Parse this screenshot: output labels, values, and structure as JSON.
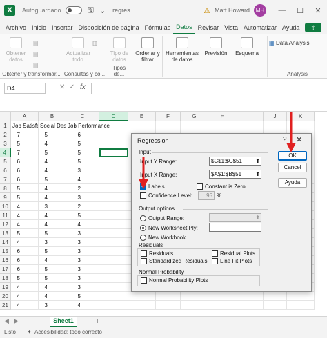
{
  "titlebar": {
    "autosave_label": "Autoguardado",
    "filename": "regres...",
    "user_name": "Matt Howard",
    "user_initials": "MH",
    "minimize": "—",
    "maximize": "☐",
    "close": "✕"
  },
  "menu": {
    "tabs": [
      "Archivo",
      "Inicio",
      "Insertar",
      "Disposición de página",
      "Fórmulas",
      "Datos",
      "Revisar",
      "Vista",
      "Automatizar",
      "Ayuda"
    ],
    "active_index": 5
  },
  "ribbon": {
    "obtener_datos": "Obtener datos",
    "actualizar_todo": "Actualizar todo",
    "tipo_de_datos": "Tipo de datos",
    "ordenar_filtrar": "Ordenar y filtrar",
    "herramientas_datos": "Herramientas de datos",
    "prevision": "Previsión",
    "esquema": "Esquema",
    "data_analysis": "Data Analysis",
    "group_obtener": "Obtener y transformar...",
    "group_consultas": "Consultas y co...",
    "group_tipos": "Tipos de...",
    "group_analysis": "Analysis"
  },
  "formula_bar": {
    "name_box": "D4",
    "cancel": "✕",
    "enter": "✓",
    "fx": "fx"
  },
  "sheet": {
    "columns": [
      "A",
      "B",
      "C",
      "D",
      "E",
      "F",
      "G",
      "H",
      "I",
      "J",
      "K"
    ],
    "rows": [
      "1",
      "2",
      "3",
      "4",
      "5",
      "6",
      "7",
      "8",
      "9",
      "10",
      "11",
      "12",
      "13",
      "14",
      "15",
      "16",
      "17",
      "18",
      "19",
      "20",
      "21"
    ],
    "headers": [
      "Job Satisfac",
      "Social Des",
      "Job Performance"
    ],
    "data": [
      [
        "7",
        "5",
        "6"
      ],
      [
        "5",
        "4",
        "5"
      ],
      [
        "7",
        "5",
        "5"
      ],
      [
        "6",
        "4",
        "5"
      ],
      [
        "6",
        "4",
        "3"
      ],
      [
        "6",
        "5",
        "4"
      ],
      [
        "5",
        "4",
        "2"
      ],
      [
        "5",
        "4",
        "3"
      ],
      [
        "4",
        "3",
        "2"
      ],
      [
        "4",
        "4",
        "5"
      ],
      [
        "4",
        "4",
        "4"
      ],
      [
        "5",
        "5",
        "3"
      ],
      [
        "4",
        "3",
        "3"
      ],
      [
        "6",
        "5",
        "3"
      ],
      [
        "6",
        "4",
        "3"
      ],
      [
        "6",
        "5",
        "3"
      ],
      [
        "5",
        "5",
        "3"
      ],
      [
        "4",
        "4",
        "3"
      ],
      [
        "4",
        "4",
        "5"
      ],
      [
        "4",
        "3",
        "4"
      ]
    ],
    "active_cell": "D4",
    "tab_name": "Sheet1",
    "add_sheet": "+"
  },
  "status": {
    "ready": "Listo",
    "accessibility": "Accesibilidad: todo correcto"
  },
  "dialog": {
    "title": "Regression",
    "help": "?",
    "close": "✕",
    "input_section": "Input",
    "input_y_label": "Input Y Range:",
    "input_y_value": "$C$1:$C$51",
    "input_x_label": "Input X Range:",
    "input_x_value": "$A$1:$B$51",
    "labels": "Labels",
    "labels_checked": true,
    "constant_is_zero": "Constant is Zero",
    "constant_checked": false,
    "confidence_level": "Confidence Level:",
    "confidence_value": "95",
    "percent": "%",
    "output_section": "Output options",
    "output_range": "Output Range:",
    "new_ply": "New Worksheet Ply:",
    "new_workbook": "New Workbook",
    "output_selected": "new_ply",
    "residuals_section": "Residuals",
    "residuals": "Residuals",
    "residual_plots": "Residual Plots",
    "standardized_residuals": "Standardized Residuals",
    "line_fit_plots": "Line Fit Plots",
    "normal_section": "Normal Probability",
    "normal_plots": "Normal Probability Plots",
    "ok": "OK",
    "cancel": "Cancel",
    "help_button": "Ayuda",
    "ref_icon": "⬆"
  },
  "colors": {
    "excel_green": "#107c41",
    "arrow_red": "#e02020"
  }
}
